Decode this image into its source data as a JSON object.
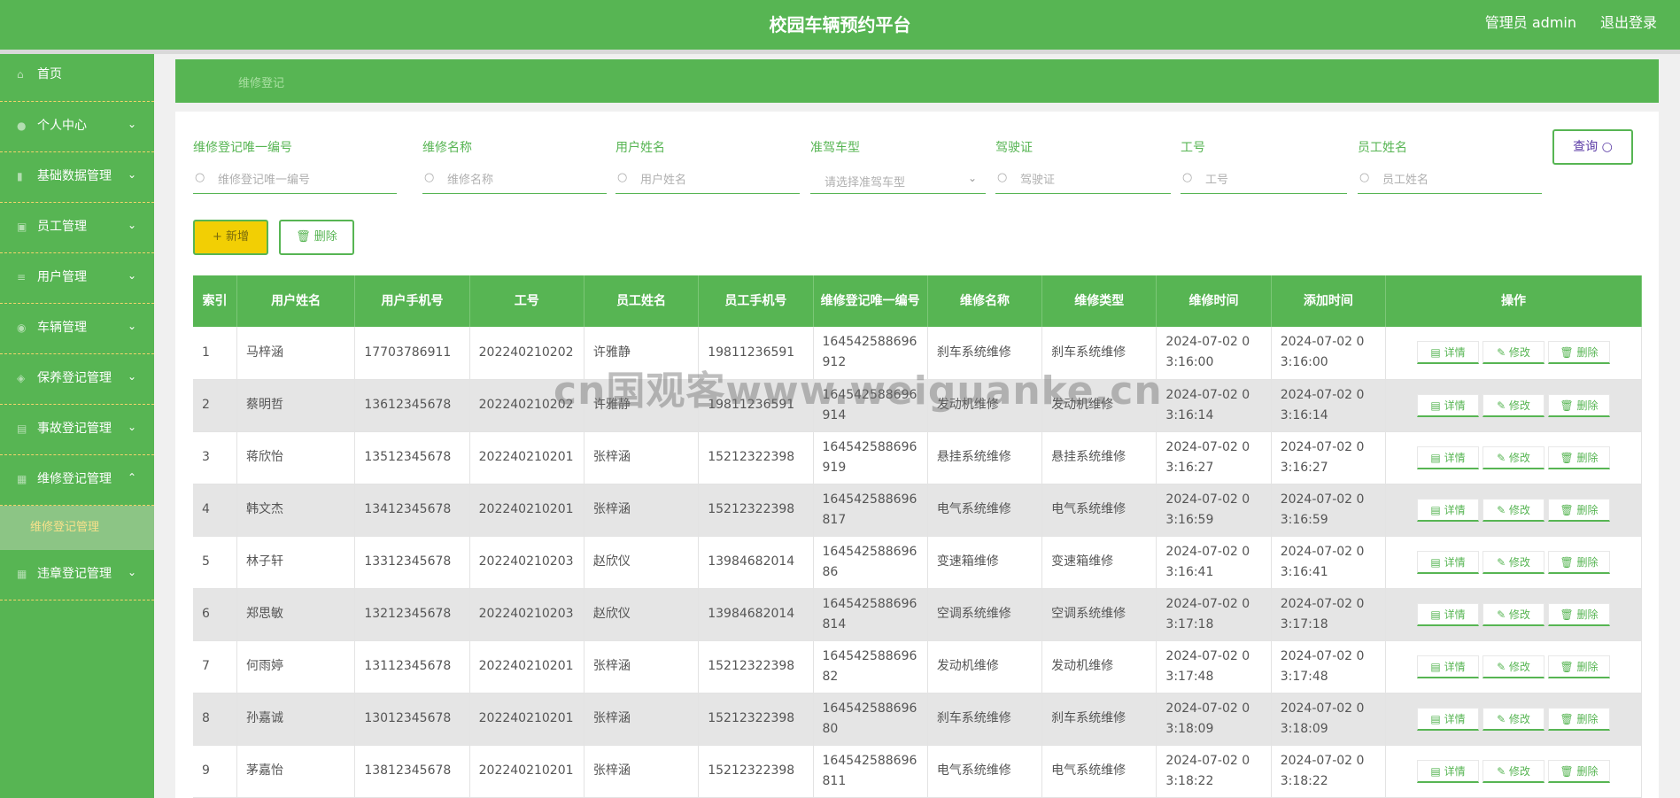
{
  "header": {
    "title": "校园车辆预约平台",
    "user": "管理员 admin",
    "logout": "退出登录"
  },
  "sidebar": {
    "items": [
      {
        "label": "首页",
        "icon": "home-icon"
      },
      {
        "label": "个人中心",
        "icon": "user-icon"
      },
      {
        "label": "基础数据管理",
        "icon": "chart-icon"
      },
      {
        "label": "员工管理",
        "icon": "id-card-icon"
      },
      {
        "label": "用户管理",
        "icon": "list-icon"
      },
      {
        "label": "车辆管理",
        "icon": "location-icon"
      },
      {
        "label": "保养登记管理",
        "icon": "shield-icon"
      },
      {
        "label": "事故登记管理",
        "icon": "document-icon"
      },
      {
        "label": "维修登记管理",
        "icon": "grid-icon"
      },
      {
        "label": "违章登记管理",
        "icon": "table-icon"
      }
    ],
    "sub_active": "维修登记管理"
  },
  "breadcrumb": "维修登记",
  "search": {
    "fields": [
      {
        "label": "维修登记唯一编号",
        "placeholder": "维修登记唯一编号"
      },
      {
        "label": "维修名称",
        "placeholder": "维修名称"
      },
      {
        "label": "用户姓名",
        "placeholder": "用户姓名"
      },
      {
        "label": "准驾车型",
        "placeholder": "请选择准驾车型"
      },
      {
        "label": "驾驶证",
        "placeholder": "驾驶证"
      },
      {
        "label": "工号",
        "placeholder": "工号"
      },
      {
        "label": "员工姓名",
        "placeholder": "员工姓名"
      }
    ],
    "query_label": "查询 ○"
  },
  "actions": {
    "add_label": "+ 新增",
    "delete_label": "🗑 删除"
  },
  "table": {
    "headers": [
      "索引",
      "用户姓名",
      "用户手机号",
      "工号",
      "员工姓名",
      "员工手机号",
      "维修登记唯一编号",
      "维修名称",
      "维修类型",
      "维修时间",
      "添加时间",
      "操作"
    ],
    "ops": {
      "detail": "▤ 详情",
      "edit": "✎ 修改",
      "delete": "🗑 删除"
    },
    "rows": [
      [
        "1",
        "马梓涵",
        "17703786911",
        "202240210202",
        "许雅静",
        "19811236591",
        "164542588696912",
        "刹车系统维修",
        "刹车系统维修",
        "2024-07-02 03:16:00",
        "2024-07-02 03:16:00"
      ],
      [
        "2",
        "蔡明哲",
        "13612345678",
        "202240210202",
        "许雅静",
        "19811236591",
        "164542588696914",
        "发动机维修",
        "发动机维修",
        "2024-07-02 03:16:14",
        "2024-07-02 03:16:14"
      ],
      [
        "3",
        "蒋欣怡",
        "13512345678",
        "202240210201",
        "张梓涵",
        "15212322398",
        "164542588696919",
        "悬挂系统维修",
        "悬挂系统维修",
        "2024-07-02 03:16:27",
        "2024-07-02 03:16:27"
      ],
      [
        "4",
        "韩文杰",
        "13412345678",
        "202240210201",
        "张梓涵",
        "15212322398",
        "164542588696817",
        "电气系统维修",
        "电气系统维修",
        "2024-07-02 03:16:59",
        "2024-07-02 03:16:59"
      ],
      [
        "5",
        "林子轩",
        "13312345678",
        "202240210203",
        "赵欣仪",
        "13984682014",
        "16454258869686",
        "变速箱维修",
        "变速箱维修",
        "2024-07-02 03:16:41",
        "2024-07-02 03:16:41"
      ],
      [
        "6",
        "郑思敏",
        "13212345678",
        "202240210203",
        "赵欣仪",
        "13984682014",
        "164542588696814",
        "空调系统维修",
        "空调系统维修",
        "2024-07-02 03:17:18",
        "2024-07-02 03:17:18"
      ],
      [
        "7",
        "何雨婷",
        "13112345678",
        "202240210201",
        "张梓涵",
        "15212322398",
        "16454258869682",
        "发动机维修",
        "发动机维修",
        "2024-07-02 03:17:48",
        "2024-07-02 03:17:48"
      ],
      [
        "8",
        "孙嘉诚",
        "13012345678",
        "202240210201",
        "张梓涵",
        "15212322398",
        "16454258869680",
        "刹车系统维修",
        "刹车系统维修",
        "2024-07-02 03:18:09",
        "2024-07-02 03:18:09"
      ],
      [
        "9",
        "茅嘉怡",
        "13812345678",
        "202240210201",
        "张梓涵",
        "15212322398",
        "164542588696811",
        "电气系统维修",
        "电气系统维修",
        "2024-07-02 03:18:22",
        "2024-07-02 03:18:22"
      ]
    ]
  },
  "watermark": "cn国观客www.weiguanke.cn",
  "colors": {
    "primary": "#57b553",
    "accent": "#f2cf04",
    "submenu": "#8cc585"
  }
}
